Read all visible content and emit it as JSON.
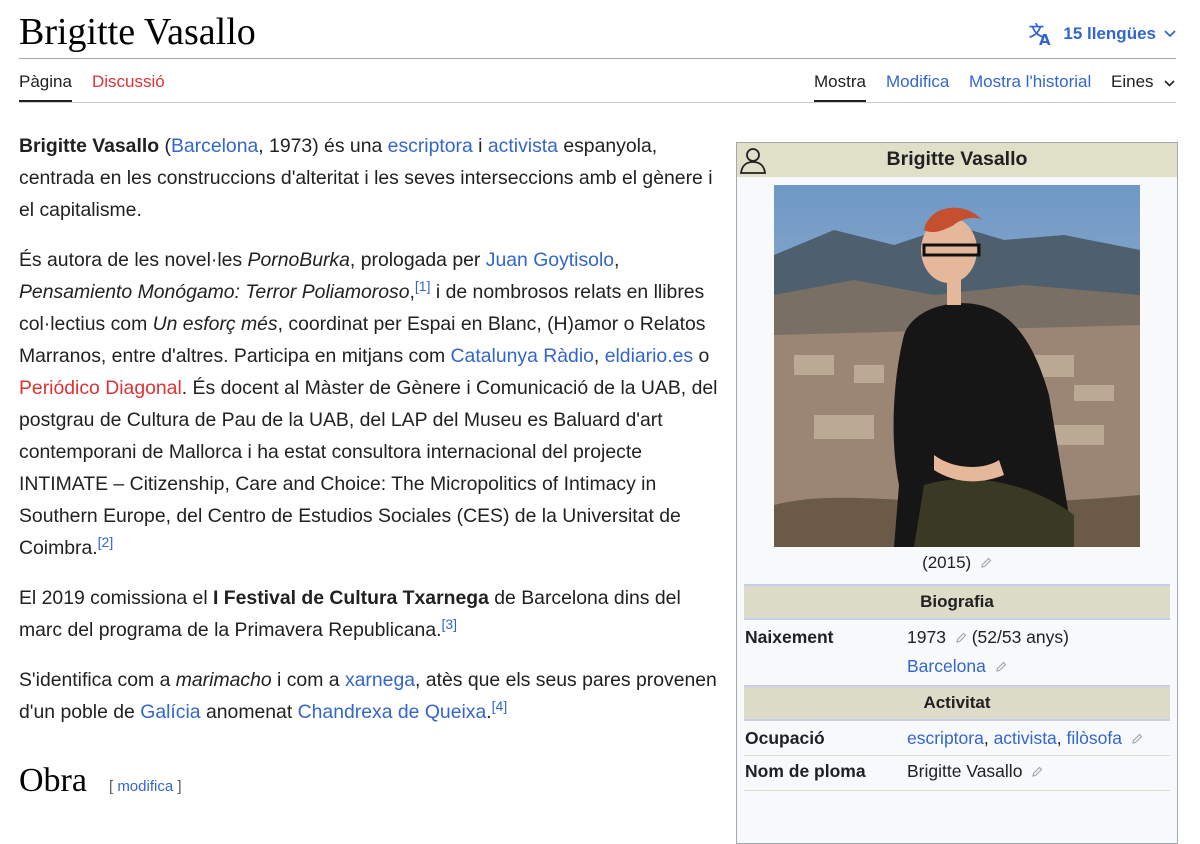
{
  "page": {
    "title": "Brigitte Vasallo",
    "languages_label": "15 llengües"
  },
  "tabs": {
    "page": "Pàgina",
    "talk": "Discussió",
    "read": "Mostra",
    "edit": "Modifica",
    "history": "Mostra l'historial",
    "tools": "Eines"
  },
  "article": {
    "p1": {
      "name": "Brigitte Vasallo",
      "t1": " (",
      "link_city": "Barcelona",
      "t2": ", 1973) és una ",
      "link_writer": "escriptora",
      "t3": " i ",
      "link_activist": "activista",
      "t4": " espanyola, centrada en les construccions d'alteritat i les seves interseccions amb el gènere i el capitalisme."
    },
    "p2": {
      "t1": "És autora de les novel·les ",
      "book1": "PornoBurka",
      "t2": ", prologada per ",
      "link_goytisolo": "Juan Goytisolo",
      "t3": ", ",
      "book2": "Pensamiento Monógamo: Terror Poliamoroso",
      "t4": ",",
      "ref1": "[1]",
      "t5": " i de nombrosos relats en llibres col·lectius com ",
      "book3": "Un esforç més",
      "t6": ", coordinat per Espai en Blanc, (H)amor o Relatos Marranos, entre d'altres. Participa en mitjans com ",
      "link_catradio": "Catalunya Ràdio",
      "t7": ", ",
      "link_eldiario": "eldiario.es",
      "t8": " o ",
      "link_diagonal": "Periódico Diagonal",
      "t9": ". És docent al Màster de Gènere i Comunicació de la UAB, del postgrau de Cultura de Pau de la UAB, del LAP del Museu es Baluard d'art contemporani de Mallorca i ha estat consultora internacional del projecte INTIMATE – Citizenship, Care and Choice: The Micropolitics of Intimacy in Southern Europe, del Centro de Estudios Sociales (CES) de la Universitat de Coimbra.",
      "ref2": "[2]"
    },
    "p3": {
      "t1": "El 2019 comissiona el ",
      "bold": "I Festival de Cultura Txarnega",
      "t2": " de Barcelona dins del marc del programa de la Primavera Republicana.",
      "ref3": "[3]"
    },
    "p4": {
      "t1": "S'identifica com a ",
      "italic": "marimacho",
      "t2": " i com a ",
      "link_xarnega": "xarnega",
      "t3": ", atès que els seus pares provenen d'un poble de ",
      "link_galicia": "Galícia",
      "t4": " anomenat ",
      "link_chandrexa": "Chandrexa de Queixa",
      "t5": ".",
      "ref4": "[4]"
    },
    "section": {
      "title": "Obra",
      "edit_open": "[ ",
      "edit_link": "modifica",
      "edit_close": " ]"
    }
  },
  "infobox": {
    "title": "Brigitte Vasallo",
    "caption": "(2015)",
    "sections": {
      "bio": "Biografia",
      "activity": "Activitat"
    },
    "birth_label": "Naixement",
    "birth_year": "1973",
    "birth_age": "(52/53 anys)",
    "birth_place": "Barcelona",
    "occupation_label": "Ocupació",
    "occupation_1": "escriptora",
    "occupation_2": "activista",
    "occupation_3": "filòsofa",
    "occ_sep": ", ",
    "pen_name_label": "Nom de ploma",
    "pen_name": "Brigitte Vasallo"
  },
  "colors": {
    "link": "#3366cc",
    "redlink": "#dd3333",
    "infobox_header": "#e0e0c8"
  },
  "icons": [
    "translate-icon",
    "chevron-down-icon",
    "person-icon",
    "pencil-icon"
  ]
}
